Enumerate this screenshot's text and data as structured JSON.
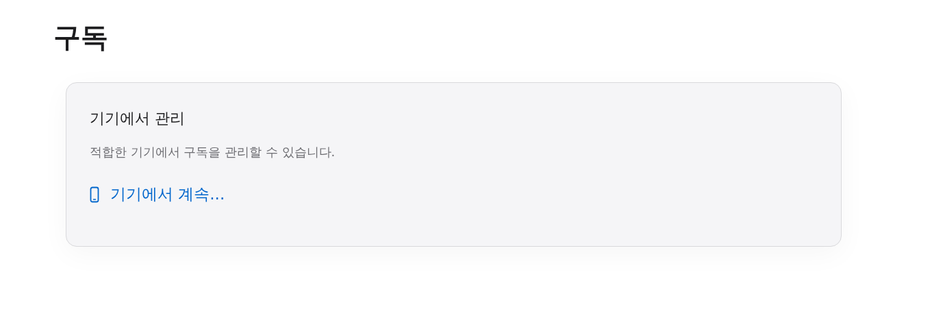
{
  "page": {
    "title": "구독"
  },
  "card": {
    "heading": "기기에서 관리",
    "description": "적합한 기기에서 구독을 관리할 수 있습니다.",
    "link": "기기에서 계속..."
  }
}
